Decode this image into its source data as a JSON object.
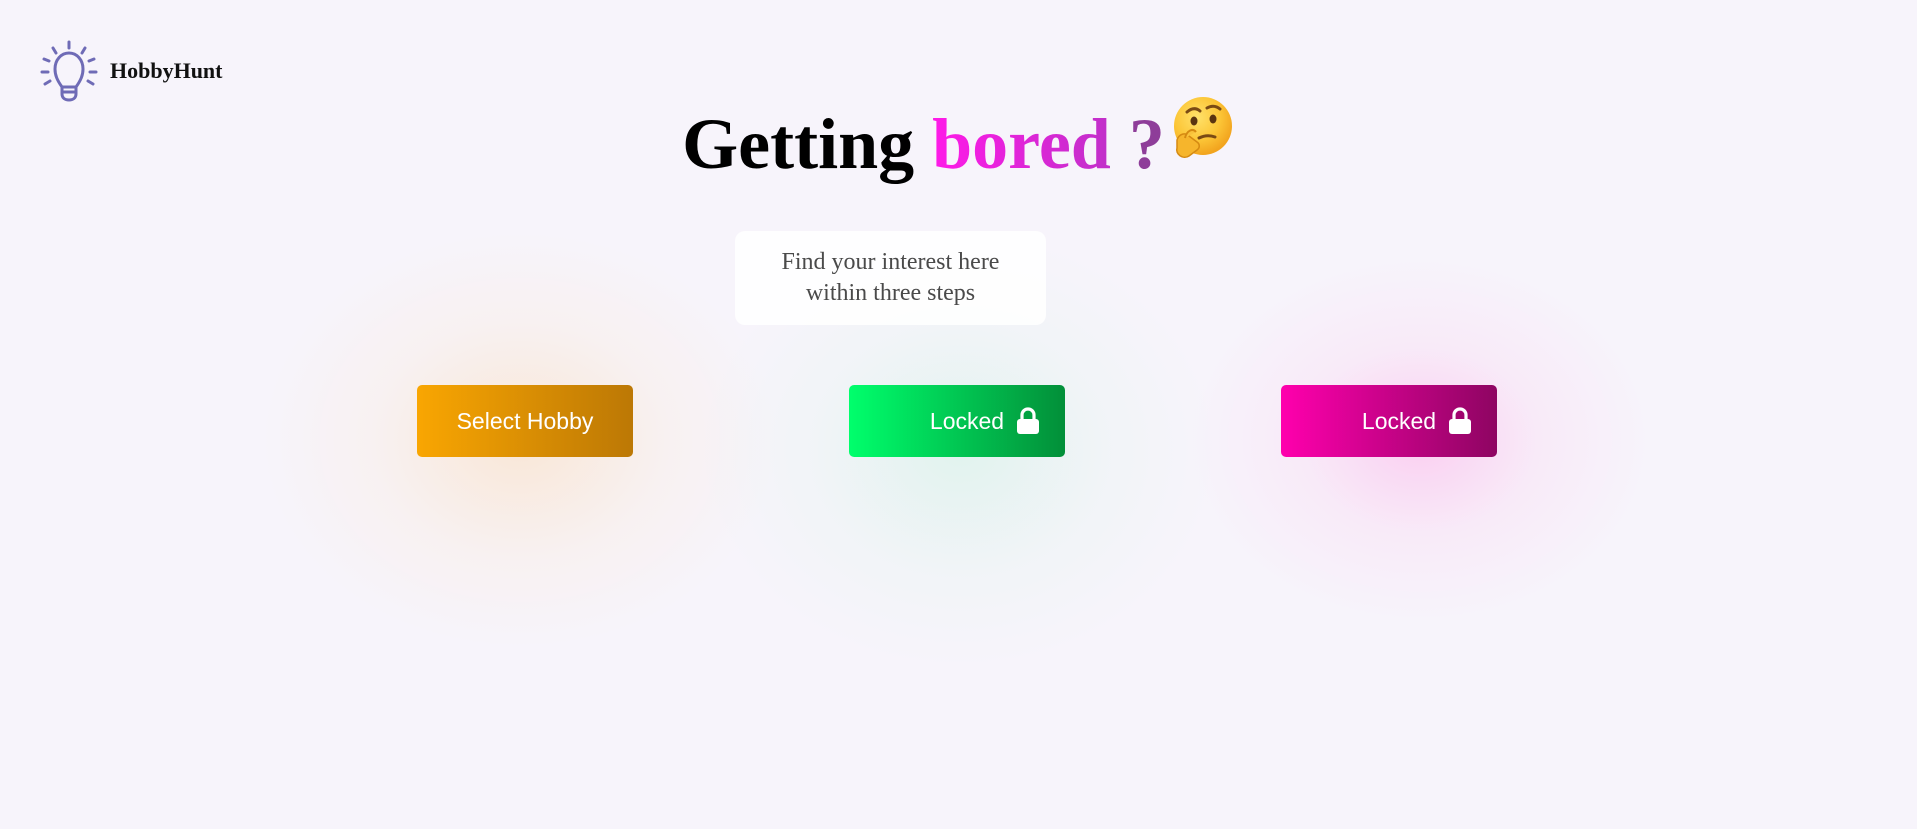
{
  "brand": {
    "name": "HobbyHunt",
    "logo_icon": "lightbulb-icon",
    "logo_color": "#6f6bb6"
  },
  "hero": {
    "word1": "Getting",
    "word2": "bored",
    "word3": "?",
    "emoji": "thinking-face-icon",
    "colors": {
      "word1": "#000000",
      "word2_start": "#ff1ae8",
      "word2_end": "#c030c9",
      "word3": "#8e3d99"
    }
  },
  "subtitle": {
    "line1": "Find your interest here",
    "line2": "within three steps"
  },
  "steps": [
    {
      "label": "Select Hobby",
      "icon": "",
      "gradient": [
        "#f9a602",
        "#bc7805"
      ]
    },
    {
      "label": "Locked",
      "icon": "lock-icon",
      "gradient": [
        "#00ff6c",
        "#028f39"
      ]
    },
    {
      "label": "Locked",
      "icon": "lock-icon",
      "gradient": [
        "#ff00ad",
        "#8e0562"
      ]
    }
  ],
  "background": "#f7f4fb"
}
